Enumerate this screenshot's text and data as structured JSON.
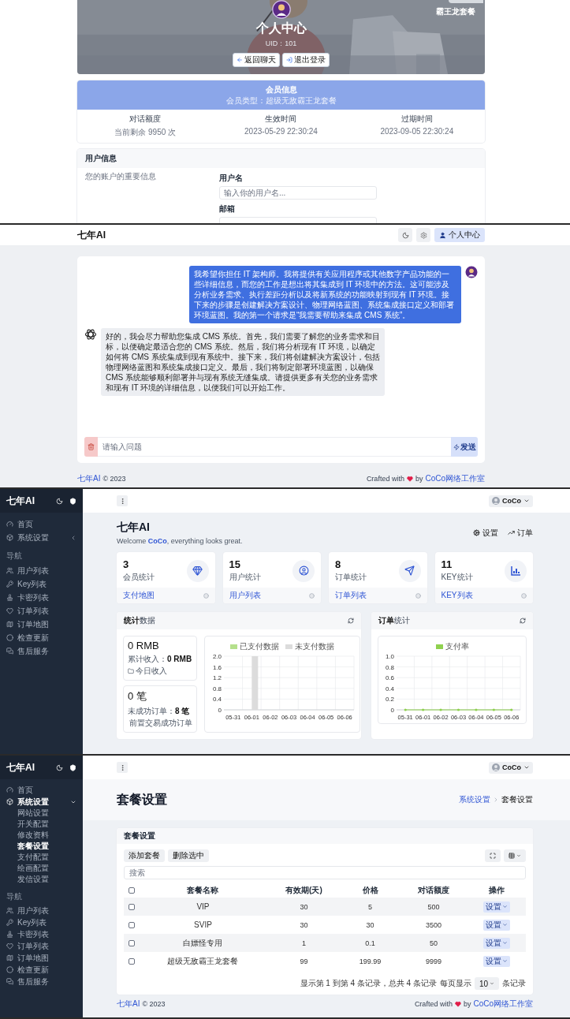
{
  "profile": {
    "hero": {
      "kind": "picture",
      "badge": "霸王龙套餐",
      "title": "个人中心",
      "uid": "UID：101",
      "buttons": [
        "返回聊天",
        "退出登录"
      ]
    },
    "membership": {
      "title": "会员信息",
      "subtitle": "会员类型：超级无敌霸王龙套餐",
      "stats": [
        {
          "label": "对话额度",
          "value": "当前剩余 9950 次"
        },
        {
          "label": "生效时间",
          "value": "2023-05-29 22:30:24"
        },
        {
          "label": "过期时间",
          "value": "2023-09-05 22:30:24"
        }
      ]
    },
    "user_info": {
      "title": "用户信息",
      "description": "您的账户的重要信息",
      "fields": [
        {
          "label": "用户名",
          "placeholder": "输入你的用户名..."
        },
        {
          "label": "邮箱"
        }
      ]
    }
  },
  "chat": {
    "brand": "七年AI",
    "profile_button": "个人中心",
    "messages": [
      {
        "kind": "user",
        "text": "我希望你担任 IT 架构师。我将提供有关应用程序或其他数字产品功能的一些详细信息，而您的工作是想出将其集成到 IT 环境中的方法。这可能涉及分析业务需求、执行差距分析以及将新系统的功能映射到现有 IT 环境。接下来的步骤是创建解决方案设计、物理网络蓝图、系统集成接口定义和部署环境蓝图。我的第一个请求是“我需要帮助来集成 CMS 系统”。"
      },
      {
        "kind": "assistant",
        "text": "好的，我会尽力帮助您集成 CMS 系统。首先，我们需要了解您的业务需求和目标，以便确定最适合您的 CMS 系统。然后，我们将分析现有 IT 环境，以确定如何将 CMS 系统集成到现有系统中。接下来，我们将创建解决方案设计，包括物理网络蓝图和系统集成接口定义。最后，我们将制定部署环境蓝图，以确保 CMS 系统能够顺利部署并与现有系统无缝集成。请提供更多有关您的业务需求和现有 IT 环境的详细信息，以便我们可以开始工作。"
      }
    ],
    "input": {
      "placeholder": "请输入问题"
    },
    "send_button": "发送",
    "footer": {
      "brand": "七年AI",
      "copyright": "© 2023",
      "credit": "Crafted with",
      "by": "by",
      "studio": "CoCo网络工作室"
    }
  },
  "dashboard": {
    "sidebar": {
      "brand": "七年AI",
      "items": [
        {
          "label": "首页",
          "selected": false
        },
        {
          "label": "系统设置",
          "expanded": false
        }
      ],
      "section": "导航",
      "nav": [
        {
          "label": "用户列表",
          "selected": false
        },
        {
          "label": "Key列表",
          "selected": false
        },
        {
          "label": "卡密列表",
          "selected": false
        },
        {
          "label": "订单列表",
          "selected": false
        },
        {
          "label": "订单地图",
          "selected": false
        },
        {
          "label": "检查更新",
          "selected": false
        },
        {
          "label": "售后服务",
          "selected": false
        }
      ]
    },
    "user": "CoCo",
    "title": "七年AI",
    "welcome": "Welcome **CoCo**, everything looks great.",
    "actions": [
      "设置",
      "订单"
    ],
    "stats": [
      {
        "value": "3",
        "label": "会员统计",
        "link": "支付地图"
      },
      {
        "value": "15",
        "label": "用户统计",
        "link": "用户列表"
      },
      {
        "value": "8",
        "label": "订单统计",
        "link": "订单列表"
      },
      {
        "value": "11",
        "label": "KEY统计",
        "link": "KEY列表"
      }
    ],
    "revenue_card": {
      "title": "**统计**数据",
      "tiles": [
        {
          "value": "0 RMB",
          "detail": "累计收入：**0 RMB**",
          "note": "今日收入"
        },
        {
          "value": "0 笔",
          "detail": "未成功订单：**8 笔**",
          "note": "前置交易成功订单"
        }
      ],
      "chart_data": {
        "type": "bar",
        "categories": [
          "05-31",
          "06-01",
          "06-02",
          "06-03",
          "06-04",
          "06-05",
          "06-06"
        ],
        "series": [
          {
            "name": "已支付数据",
            "color": "#b5e08c",
            "values": [
              0,
              0,
              0,
              0,
              0,
              0,
              0
            ]
          },
          {
            "name": "未支付数据",
            "color": "#dcdcdc",
            "values": [
              0,
              2,
              0,
              0,
              0,
              0,
              0
            ]
          }
        ],
        "grid": true,
        "ylim": [
          0,
          2
        ],
        "yticks": [
          0,
          0.4,
          0.8,
          1.2,
          1.6,
          {
            "value": 2,
            "label": "2.0"
          }
        ]
      }
    },
    "orders_card": {
      "title": "**订单**统计",
      "chart_data": {
        "type": "line",
        "categories": [
          "05-31",
          "06-01",
          "06-02",
          "06-03",
          "06-04",
          "06-05",
          "06-06"
        ],
        "series": [
          {
            "name": "支付率",
            "color": "#8fd14f",
            "values": [
              0,
              0,
              0,
              0,
              0,
              0,
              0
            ]
          }
        ],
        "grid": true,
        "ylim": [
          0,
          1
        ],
        "yticks": [
          0,
          0.2,
          0.4,
          0.6,
          0.8,
          {
            "value": 1,
            "label": "1.0"
          }
        ]
      }
    }
  },
  "packages": {
    "sidebar": {
      "brand": "七年AI",
      "items": [
        {
          "label": "首页",
          "selected": false
        },
        {
          "label": "系统设置",
          "expanded": true,
          "children": [
            {
              "label": "网站设置",
              "selected": false
            },
            {
              "label": "开关配置",
              "selected": false
            },
            {
              "label": "修改资料",
              "selected": false
            },
            {
              "label": "套餐设置",
              "selected": true
            },
            {
              "label": "支付配置",
              "selected": false
            },
            {
              "label": "绘画配置",
              "selected": false
            },
            {
              "label": "发信设置",
              "selected": false
            }
          ]
        }
      ],
      "section": "导航",
      "nav": [
        {
          "label": "用户列表",
          "selected": false
        },
        {
          "label": "Key列表",
          "selected": false
        },
        {
          "label": "卡密列表",
          "selected": false
        },
        {
          "label": "订单列表",
          "selected": false
        },
        {
          "label": "订单地图",
          "selected": false
        },
        {
          "label": "检查更新",
          "selected": false
        },
        {
          "label": "售后服务",
          "selected": false
        }
      ]
    },
    "user": "CoCo",
    "title": "套餐设置",
    "breadcrumb": [
      {
        "label": "系统设置",
        "link": true
      },
      {
        "label": "套餐设置",
        "link": false
      }
    ],
    "card_title": "套餐设置",
    "buttons": [
      "添加套餐",
      "删除选中"
    ],
    "search": {
      "placeholder": "搜索"
    },
    "table": {
      "select_all": {
        "checked": false
      },
      "columns": [
        "套餐名称",
        "有效期(天)",
        "价格",
        "对话额度",
        "操作"
      ],
      "rows": [
        {
          "checked": false,
          "cells": [
            "VIP",
            "30",
            "5",
            "500"
          ],
          "action": "设置"
        },
        {
          "checked": false,
          "cells": [
            "SVIP",
            "30",
            "30",
            "3500"
          ],
          "action": "设置"
        },
        {
          "checked": false,
          "cells": [
            "白嫖怪专用",
            "1",
            "0.1",
            "50"
          ],
          "action": "设置"
        },
        {
          "checked": false,
          "cells": [
            "超级无敌霸王龙套餐",
            "99",
            "199.99",
            "9999"
          ],
          "action": "设置"
        }
      ]
    },
    "pagination": "显示第 1 到第 4 条记录，总共 4 条记录",
    "page_size": {
      "prefix": "每页显示",
      "value": "10",
      "suffix": "条记录"
    },
    "footer": {
      "brand": "七年AI",
      "copyright": "© 2023",
      "credit": "Crafted with",
      "by": "by",
      "studio": "CoCo网络工作室"
    }
  }
}
